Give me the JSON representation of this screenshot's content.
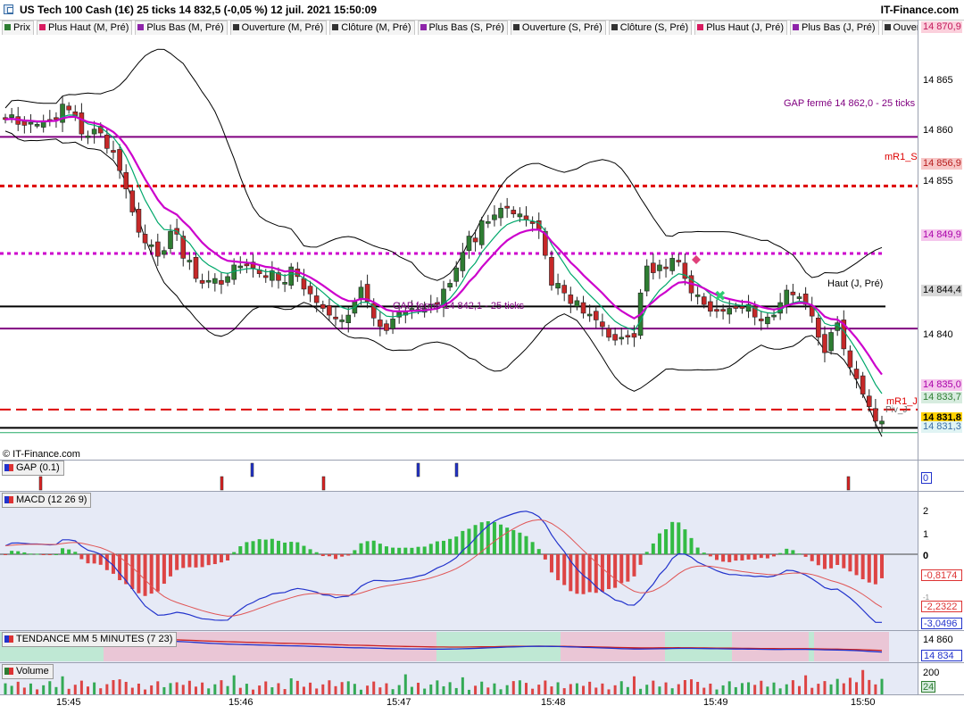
{
  "header": {
    "title": "US Tech 100 Cash (1€) 25 ticks 14 832,5 (-0,05 %) 12 juil. 2021 15:50:09",
    "brand": "IT-Finance.com"
  },
  "legend": [
    {
      "label": "Prix",
      "color": "#2e7d32"
    },
    {
      "label": "Plus Haut (M, Pré)",
      "color": "#d81b60"
    },
    {
      "label": "Plus Bas (M, Pré)",
      "color": "#8e24aa"
    },
    {
      "label": "Ouverture (M, Pré)",
      "color": "#333333"
    },
    {
      "label": "Clôture (M, Pré)",
      "color": "#333333"
    },
    {
      "label": "Plus Bas (S, Pré)",
      "color": "#8e24aa"
    },
    {
      "label": "Ouverture (S, Pré)",
      "color": "#333333"
    },
    {
      "label": "Clôture (S, Pré)",
      "color": "#333333"
    },
    {
      "label": "Plus Haut (J, Pré)",
      "color": "#d81b60"
    },
    {
      "label": "Plus Bas (J, Pré)",
      "color": "#8e24aa"
    },
    {
      "label": "Ouverture",
      "color": "#333333"
    }
  ],
  "main": {
    "credit": "© IT-Finance.com",
    "annotations": {
      "gap_top": "GAP fermé 14 862,0 - 25 ticks",
      "gap_bottom": "GAP fermé 14 842,1 - 25 ticks",
      "mr1s": "mR1_S",
      "haut_j": "Haut (J, Pré)",
      "mr1j": "mR1_J",
      "pivj": "Piv_J"
    },
    "yticks": [
      "14 865",
      "14 860",
      "14 855",
      "14 840"
    ],
    "price_labels": [
      "14 870,9",
      "14 856,9",
      "14 849,9",
      "14 844,4",
      "14 835,0",
      "14 833,7",
      "14 831,8",
      "14 831,3"
    ],
    "lines": {
      "gap_top": 14862.0,
      "mr1s": 14856.9,
      "dotted": 14849.9,
      "haut_j": 14844.4,
      "gap_bottom": 14842.1,
      "mr1j": 14833.7,
      "last": 14831.8,
      "pivj": 14831.3
    }
  },
  "gap": {
    "title": "GAP (0.1)",
    "value_label": "0"
  },
  "macd": {
    "title": "MACD (12 26 9)",
    "ticks": [
      "2",
      "1",
      "0",
      "-1"
    ],
    "labels": [
      "-0,8174",
      "-2,2322",
      "-3,0496"
    ]
  },
  "trend": {
    "title": "TENDANCE MM 5 MINUTES (7 23)",
    "labels": [
      "14 860",
      "14 834"
    ]
  },
  "volume": {
    "title": "Volume",
    "labels": [
      "200",
      "24"
    ]
  },
  "time_labels": [
    "15:45",
    "15:46",
    "15:47",
    "15:48",
    "15:49",
    "15:50"
  ],
  "colors": {
    "up": "#2e7d32",
    "down": "#c62828",
    "ma_fast": "#00a86b",
    "ma_slow": "#cc00cc",
    "band": "#000000",
    "gap_line": "#800080",
    "pivot_red": "#dd0000",
    "pivot_purple": "#cc00cc",
    "macd": "#2233cc",
    "signal": "#e05555",
    "trend_up": "#bfe8d4",
    "trend_down": "#eac6d6",
    "panel_bg": "#e6eaf6"
  },
  "chart_data": {
    "type": "candlestick",
    "title": "US Tech 100 Cash (1€) 25 ticks",
    "x_labels": [
      "15:45",
      "15:46",
      "15:47",
      "15:48",
      "15:49",
      "15:50"
    ],
    "ylim": [
      14828.5,
      14872.5
    ],
    "close": [
      14863.8,
      14864.3,
      14863.3,
      14863.2,
      14863.5,
      14863.3,
      14863.6,
      14863.8,
      14863.8,
      14865.4,
      14864.8,
      14864.2,
      14862.3,
      14862.1,
      14862.8,
      14862.4,
      14860.8,
      14860.4,
      14858.5,
      14856.6,
      14854.2,
      14852.1,
      14851.0,
      14850.8,
      14849.6,
      14850.2,
      14852.2,
      14851.9,
      14849.4,
      14849.2,
      14847.3,
      14846.8,
      14847.1,
      14847.3,
      14846.7,
      14847.5,
      14848.7,
      14848.6,
      14848.7,
      14848.4,
      14847.8,
      14847.4,
      14848.1,
      14847.1,
      14846.9,
      14848.5,
      14847.5,
      14846.2,
      14845.7,
      14844.8,
      14844.2,
      14843.5,
      14843.1,
      14843.0,
      14843.5,
      14844.9,
      14846.4,
      14844.9,
      14843.2,
      14842.3,
      14841.9,
      14843.1,
      14843.8,
      14843.9,
      14844.2,
      14844.1,
      14844.2,
      14844.6,
      14844.6,
      14846.2,
      14846.8,
      14848.4,
      14850.0,
      14851.7,
      14851.1,
      14853.3,
      14853.2,
      14853.9,
      14854.6,
      14854.6,
      14854.0,
      14854.0,
      14853.4,
      14853.0,
      14852.4,
      14849.7,
      14846.6,
      14846.8,
      14845.8,
      14844.7,
      14845.0,
      14843.7,
      14843.6,
      14843.0,
      14842.3,
      14841.2,
      14840.9,
      14841.2,
      14841.3,
      14841.2,
      14845.8,
      14848.6,
      14847.9,
      14848.7,
      14848.4,
      14849.4,
      14849.1,
      14847.3,
      14845.8,
      14845.6,
      14844.6,
      14843.9,
      14843.9,
      14843.9,
      14844.2,
      14844.2,
      14844.2,
      14844.6,
      14843.3,
      14842.9,
      14843.3,
      14843.5,
      14844.8,
      14846.1,
      14845.6,
      14845.4,
      14844.6,
      14843.4,
      14841.2,
      14839.6,
      14841.7,
      14842.7,
      14840.0,
      14838.1,
      14836.9,
      14835.3,
      14834.0,
      14832.5,
      14832.5
    ],
    "series": [
      {
        "name": "MACD (12 26 9)",
        "values": [
          0.38,
          0.5,
          0.51,
          0.49,
          0.46,
          0.46,
          0.44,
          0.42,
          0.44,
          0.65,
          0.65,
          0.6,
          0.36,
          0.18,
          0.11,
          0.0,
          -0.26,
          -0.5,
          -0.86,
          -1.18,
          -1.56,
          -1.95,
          -2.32,
          -2.53,
          -2.73,
          -2.72,
          -2.67,
          -2.6,
          -2.64,
          -2.71,
          -2.81,
          -2.89,
          -2.91,
          -2.95,
          -2.96,
          -2.95,
          -2.7,
          -2.48,
          -2.28,
          -2.16,
          -2.0,
          -1.91,
          -1.78,
          -1.74,
          -1.71,
          -1.6,
          -1.53,
          -1.57,
          -1.63,
          -1.7,
          -1.82,
          -1.84,
          -1.95,
          -1.9,
          -1.88,
          -1.7,
          -1.43,
          -1.28,
          -1.17,
          -1.18,
          -1.2,
          -1.19,
          -1.15,
          -1.1,
          -1.06,
          -0.98,
          -0.92,
          -0.77,
          -0.61,
          -0.5,
          -0.34,
          -0.15,
          0.17,
          0.41,
          0.72,
          1.02,
          1.28,
          1.48,
          1.62,
          1.72,
          1.82,
          1.9,
          1.93,
          1.85,
          1.69,
          1.36,
          0.87,
          0.47,
          0.12,
          -0.31,
          -0.66,
          -0.95,
          -1.16,
          -1.45,
          -1.68,
          -1.85,
          -2.05,
          -2.12,
          -2.27,
          -2.28,
          -2.03,
          -1.65,
          -1.34,
          -0.91,
          -0.62,
          -0.19,
          0.02,
          0.0,
          -0.13,
          -0.35,
          -0.48,
          -0.6,
          -0.74,
          -0.84,
          -0.91,
          -0.91,
          -0.95,
          -0.96,
          -1.0,
          -0.98,
          -1.02,
          -0.98,
          -0.88,
          -0.72,
          -0.73,
          -0.82,
          -0.93,
          -1.1,
          -1.29,
          -1.5,
          -1.58,
          -1.56,
          -1.75,
          -1.96,
          -2.21,
          -2.5,
          -2.79,
          -3.05,
          -3.05
        ]
      }
    ]
  }
}
